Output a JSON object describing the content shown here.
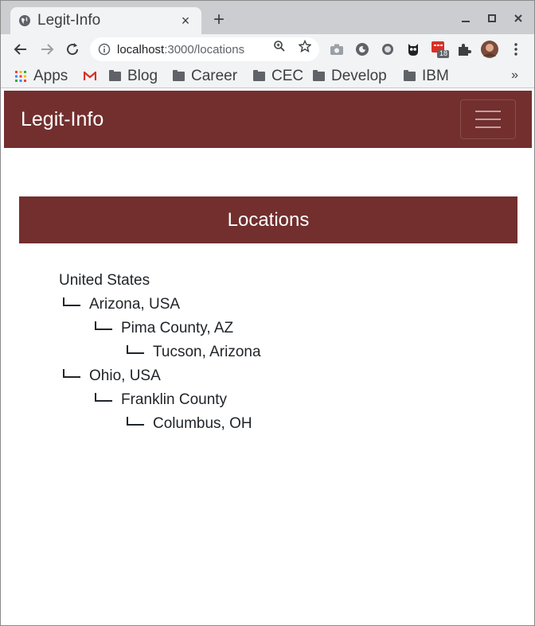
{
  "browser": {
    "tab": {
      "title": "Legit-Info",
      "close_label": "×"
    },
    "new_tab_label": "+",
    "address": {
      "host": "localhost",
      "path": ":3000/locations"
    },
    "bookmarks": [
      {
        "label": "Apps",
        "icon": "apps-grid-icon"
      },
      {
        "label": "",
        "icon": "gmail-icon"
      },
      {
        "label": "Blog",
        "icon": "folder-icon"
      },
      {
        "label": "Career",
        "icon": "folder-icon"
      },
      {
        "label": "CEC",
        "icon": "folder-icon"
      },
      {
        "label": "Develop",
        "icon": "folder-icon"
      },
      {
        "label": "IBM",
        "icon": "folder-icon"
      }
    ],
    "bookmarks_more": "»",
    "extension_badge": "18"
  },
  "app": {
    "brand": "Legit-Info",
    "brand_color": "#722f2e",
    "page_heading": "Locations"
  },
  "locations": [
    {
      "name": "United States",
      "depth": 0
    },
    {
      "name": "Arizona, USA",
      "depth": 1
    },
    {
      "name": "Pima County, AZ",
      "depth": 2
    },
    {
      "name": "Tucson, Arizona",
      "depth": 3
    },
    {
      "name": "Ohio, USA",
      "depth": 1
    },
    {
      "name": "Franklin County",
      "depth": 2
    },
    {
      "name": "Columbus, OH",
      "depth": 3
    }
  ]
}
